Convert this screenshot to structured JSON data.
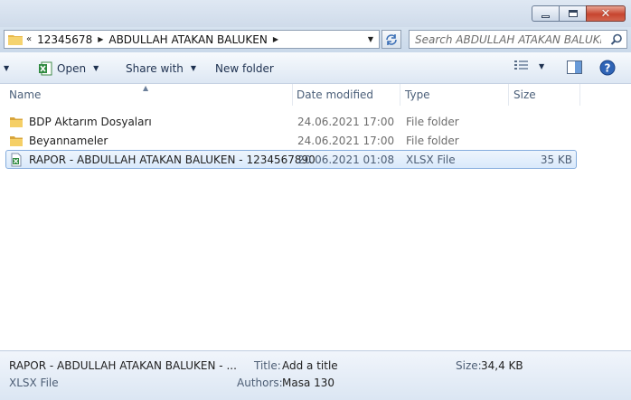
{
  "address": {
    "overflow": "«",
    "crumbs": [
      "12345678",
      "ABDULLAH ATAKAN BALUKEN"
    ]
  },
  "search": {
    "placeholder": "Search ABDULLAH ATAKAN BALUKEN"
  },
  "toolbar": {
    "open_label": "Open",
    "share_label": "Share with",
    "newfolder_label": "New folder"
  },
  "columns": {
    "name": "Name",
    "date": "Date modified",
    "type": "Type",
    "size": "Size"
  },
  "files": [
    {
      "name": "BDP Aktarım Dosyaları",
      "date": "24.06.2021 17:00",
      "type": "File folder",
      "size": "",
      "icon": "folder-icon"
    },
    {
      "name": "Beyannameler",
      "date": "24.06.2021 17:00",
      "type": "File folder",
      "size": "",
      "icon": "folder-icon"
    },
    {
      "name": "RAPOR - ABDULLAH ATAKAN BALUKEN - 1234567890",
      "date": "20.06.2021 01:08",
      "type": "XLSX File",
      "size": "35 KB",
      "icon": "excel-file-icon",
      "selected": true
    }
  ],
  "details": {
    "filename": "RAPOR - ABDULLAH ATAKAN BALUKEN - ...",
    "filetype": "XLSX File",
    "title_label": "Title:",
    "title_value": "Add a title",
    "authors_label": "Authors:",
    "authors_value": "Masa 130",
    "size_label": "Size:",
    "size_value": "34,4 KB"
  },
  "colors": {
    "accent": "#1e3150",
    "selection_border": "#84acdd",
    "close_button": "#c7452f"
  }
}
